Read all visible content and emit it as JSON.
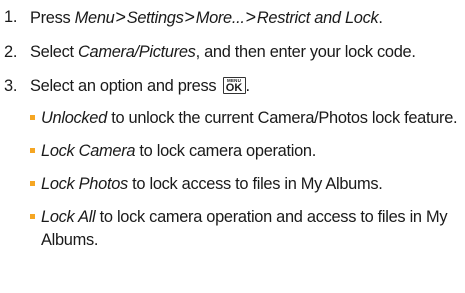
{
  "steps": [
    {
      "num": "1.",
      "prefix": "Press ",
      "menu_path": [
        "Menu",
        "Settings",
        "More...",
        "Restrict and Lock"
      ],
      "separator": ">",
      "suffix": "."
    },
    {
      "num": "2.",
      "prefix": "Select ",
      "emph": "Camera/Pictures",
      "suffix": ", and then enter your lock code."
    },
    {
      "num": "3.",
      "prefix": "Select an option and press ",
      "key_top": "MENU",
      "key_main": "OK",
      "suffix": "."
    }
  ],
  "options": [
    {
      "label": "Unlocked",
      "text": " to unlock the current Camera/Photos lock feature."
    },
    {
      "label": "Lock Camera",
      "text": " to lock camera operation."
    },
    {
      "label": "Lock Photos",
      "text": " to lock access to files in My Albums."
    },
    {
      "label": "Lock All",
      "text": " to lock camera operation and access to files in My Albums."
    }
  ],
  "colors": {
    "bullet": "#f5a623",
    "text": "#1a1a1a"
  },
  "icons": {
    "menu_ok_key": "menu-ok-key-icon",
    "bullet": "square-bullet-icon"
  }
}
